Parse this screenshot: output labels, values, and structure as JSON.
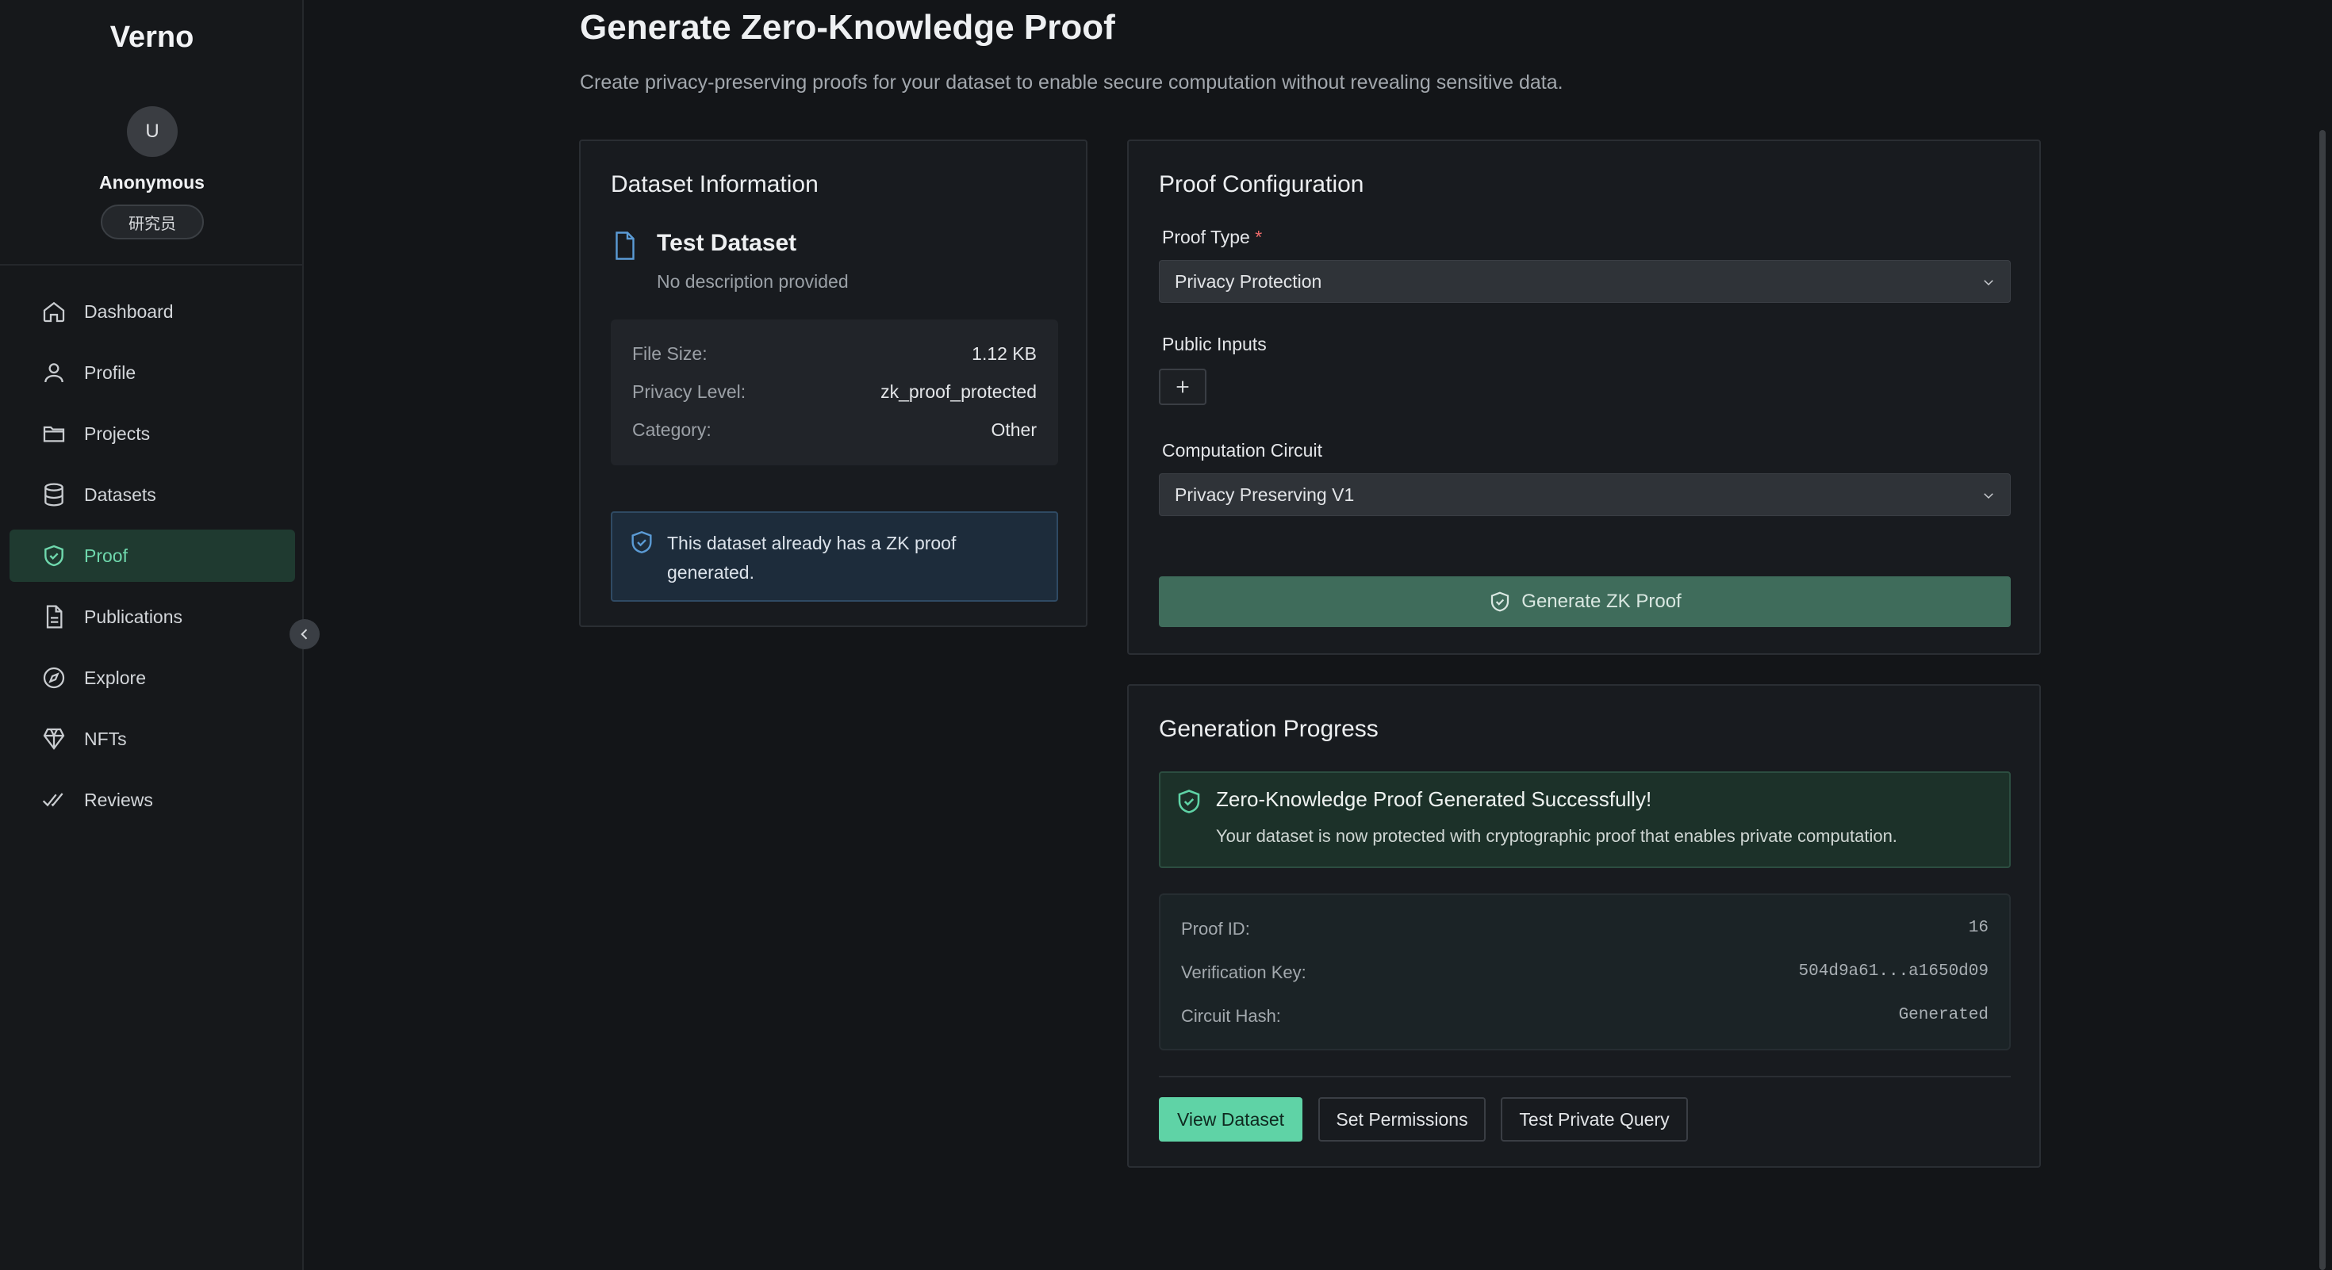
{
  "sidebar": {
    "brand": "Verno",
    "avatar_initial": "U",
    "username": "Anonymous",
    "role": "研究员",
    "items": [
      {
        "label": "Dashboard",
        "icon": "home-icon"
      },
      {
        "label": "Profile",
        "icon": "user-icon"
      },
      {
        "label": "Projects",
        "icon": "folder-icon"
      },
      {
        "label": "Datasets",
        "icon": "database-icon"
      },
      {
        "label": "Proof",
        "icon": "shield-icon",
        "active": true
      },
      {
        "label": "Publications",
        "icon": "document-icon"
      },
      {
        "label": "Explore",
        "icon": "compass-icon"
      },
      {
        "label": "NFTs",
        "icon": "gem-icon"
      },
      {
        "label": "Reviews",
        "icon": "double-check-icon"
      }
    ]
  },
  "header": {
    "title": "Generate Zero-Knowledge Proof",
    "subtitle": "Create privacy-preserving proofs for your dataset to enable secure computation without revealing sensitive data."
  },
  "dataset": {
    "title": "Dataset Information",
    "name": "Test Dataset",
    "description": "No description provided",
    "meta": {
      "file_size_label": "File Size:",
      "file_size": "1.12 KB",
      "privacy_label": "Privacy Level:",
      "privacy": "zk_proof_protected",
      "category_label": "Category:",
      "category": "Other"
    },
    "alert": "This dataset already has a ZK proof generated."
  },
  "config": {
    "title": "Proof Configuration",
    "proof_type_label": "Proof Type",
    "required_mark": "*",
    "proof_type_value": "Privacy Protection",
    "public_inputs_label": "Public Inputs",
    "circuit_label": "Computation Circuit",
    "circuit_value": "Privacy Preserving V1",
    "generate_label": "Generate ZK Proof"
  },
  "progress": {
    "title": "Generation Progress",
    "success_title": "Zero-Knowledge Proof Generated Successfully!",
    "success_desc": "Your dataset is now protected with cryptographic proof that enables private computation.",
    "details": {
      "proof_id_label": "Proof ID:",
      "proof_id": "16",
      "vk_label": "Verification Key:",
      "vk": "504d9a61...a1650d09",
      "circuit_hash_label": "Circuit Hash:",
      "circuit_hash": "Generated"
    },
    "buttons": {
      "view": "View Dataset",
      "permissions": "Set Permissions",
      "query": "Test Private Query"
    }
  },
  "colors": {
    "accent": "#5fd3a6",
    "active_nav_bg": "#1f3a30",
    "background": "#131518"
  }
}
